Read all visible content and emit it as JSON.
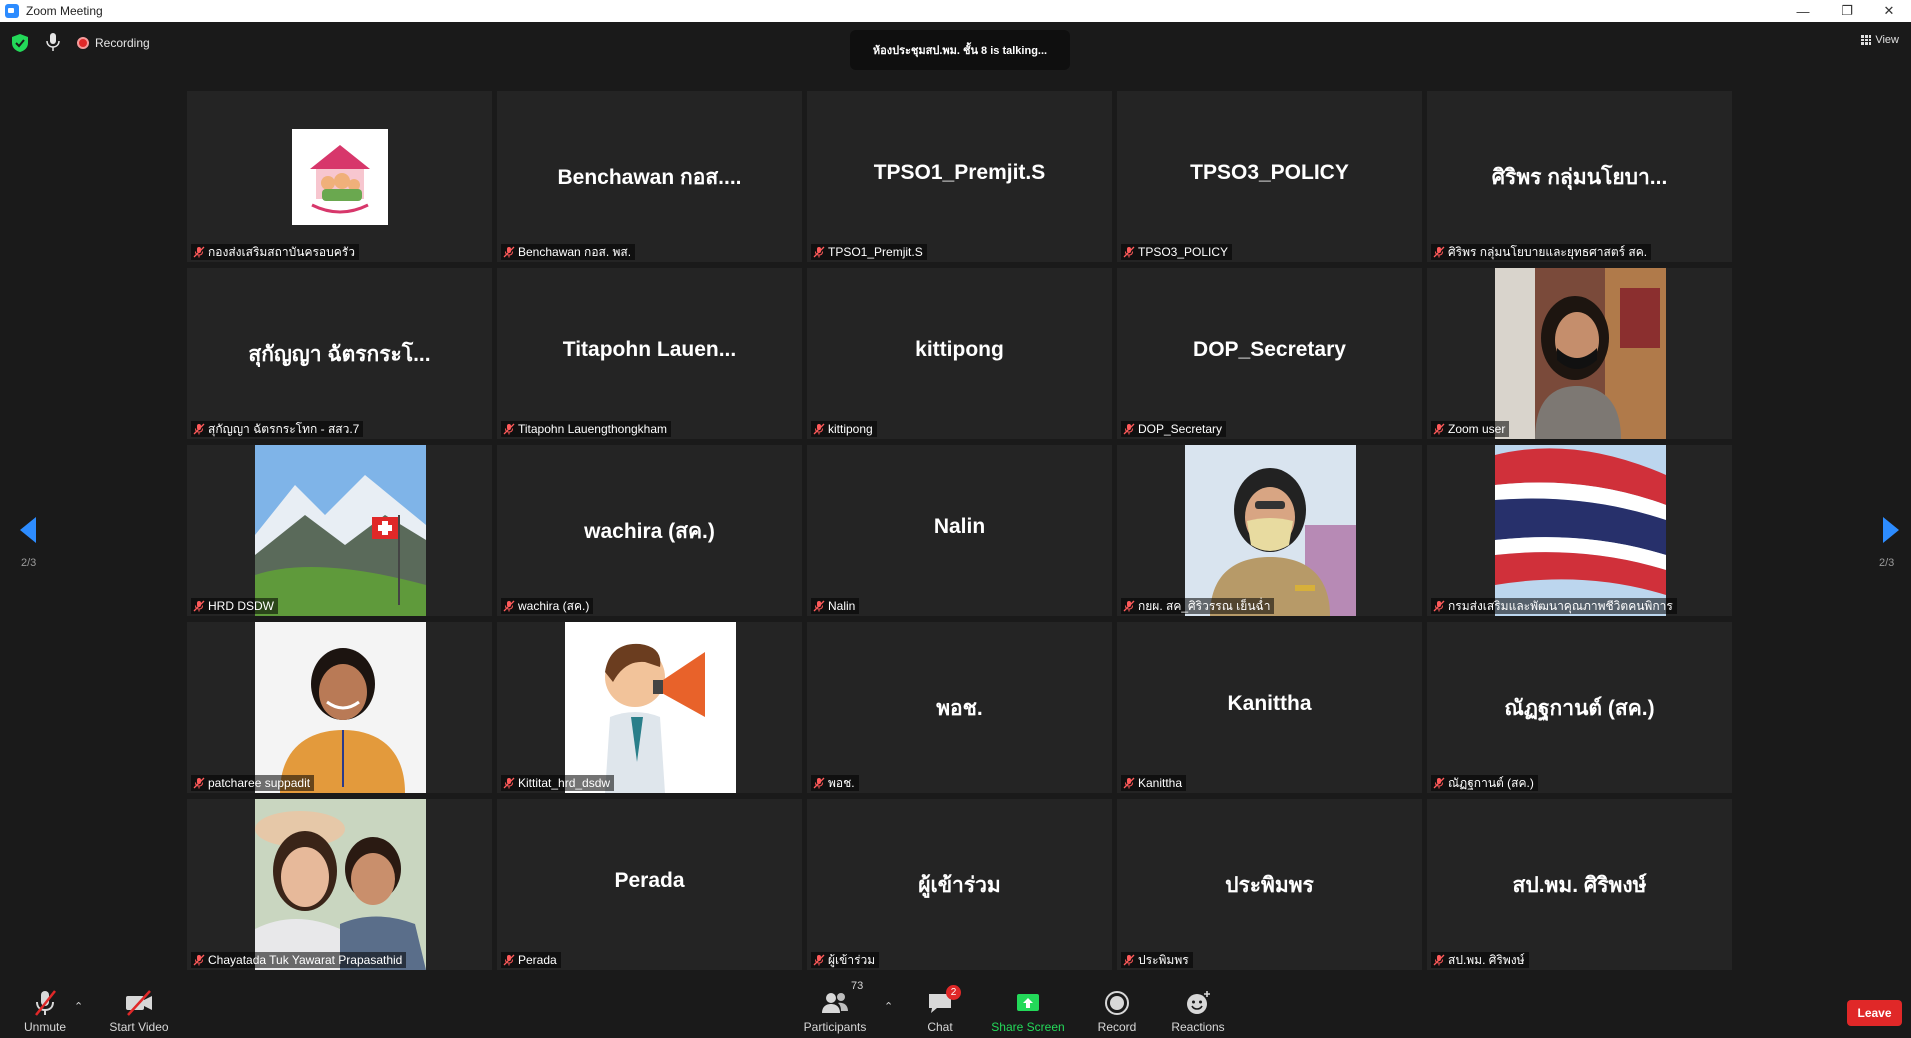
{
  "window": {
    "title": "Zoom Meeting",
    "controls": [
      "—",
      "❐",
      "✕"
    ]
  },
  "topbar": {
    "recording_label": "Recording",
    "talking_text": "ห้องประชุมสป.พม. ชั้น 8 is talking...",
    "view_label": "View"
  },
  "pager": {
    "left": "2/3",
    "right": "2/3"
  },
  "tiles": [
    {
      "display": "logo",
      "name": "กองส่งเสริมสถาบันครอบครัว"
    },
    {
      "display": "text",
      "big": "Benchawan กอส....",
      "name": "Benchawan กอส. พส."
    },
    {
      "display": "text",
      "big": "TPSO1_Premjit.S",
      "name": "TPSO1_Premjit.S"
    },
    {
      "display": "text",
      "big": "TPSO3_POLICY",
      "name": "TPSO3_POLICY"
    },
    {
      "display": "text",
      "big": "ศิริพร กลุ่มนโยบา...",
      "name": "ศิริพร กลุ่มนโยบายและยุทธศาสตร์ สค."
    },
    {
      "display": "text",
      "big": "สุกัญญา ฉัตรกระโ...",
      "name": "สุกัญญา ฉัตรกระโทก - สสว.7"
    },
    {
      "display": "text",
      "big": "Titapohn  Lauen...",
      "name": "Titapohn Lauengthongkham"
    },
    {
      "display": "text",
      "big": "kittipong",
      "name": "kittipong"
    },
    {
      "display": "text",
      "big": "DOP_Secretary",
      "name": "DOP_Secretary"
    },
    {
      "display": "photo-woman-mask",
      "name": "Zoom user"
    },
    {
      "display": "photo-mountain",
      "name": "HRD DSDW"
    },
    {
      "display": "text",
      "big": "wachira (สค.)",
      "name": "wachira (สค.)"
    },
    {
      "display": "text",
      "big": "Nalin",
      "name": "Nalin"
    },
    {
      "display": "photo-official",
      "name": "กยผ. สค_ศิริวรรณ เย็นฉ่ำ"
    },
    {
      "display": "photo-flag",
      "name": "กรมส่งเสริมและพัฒนาคุณภาพชีวิตคนพิการ"
    },
    {
      "display": "photo-woman",
      "name": "patcharee suppadit"
    },
    {
      "display": "photo-megaphone",
      "name": "Kittitat_hrd_dsdw"
    },
    {
      "display": "text",
      "big": "พอช.",
      "name": "พอช."
    },
    {
      "display": "text",
      "big": "Kanittha",
      "name": "Kanittha"
    },
    {
      "display": "text",
      "big": "ณัฏฐกานต์ (สค.)",
      "name": "ณัฏฐกานต์ (สค.)"
    },
    {
      "display": "photo-selfie",
      "name": "Chayatada Tuk Yawarat Prapasathid"
    },
    {
      "display": "text",
      "big": "Perada",
      "name": "Perada"
    },
    {
      "display": "text",
      "big": "ผู้เข้าร่วม",
      "name": "ผู้เข้าร่วม"
    },
    {
      "display": "text",
      "big": "ประพิมพร",
      "name": "ประพิมพร"
    },
    {
      "display": "text",
      "big": "สป.พม. ศิริพงษ์",
      "name": "สป.พม. ศิริพงษ์"
    }
  ],
  "toolbar": {
    "unmute": "Unmute",
    "start_video": "Start Video",
    "participants": "Participants",
    "participants_count": "73",
    "chat": "Chat",
    "chat_badge": "2",
    "share_screen": "Share Screen",
    "record": "Record",
    "reactions": "Reactions",
    "leave": "Leave"
  },
  "colors": {
    "accent_green": "#23d959",
    "leave_red": "#e02828",
    "nav_blue": "#2d8cff",
    "tile_bg": "#242424"
  }
}
